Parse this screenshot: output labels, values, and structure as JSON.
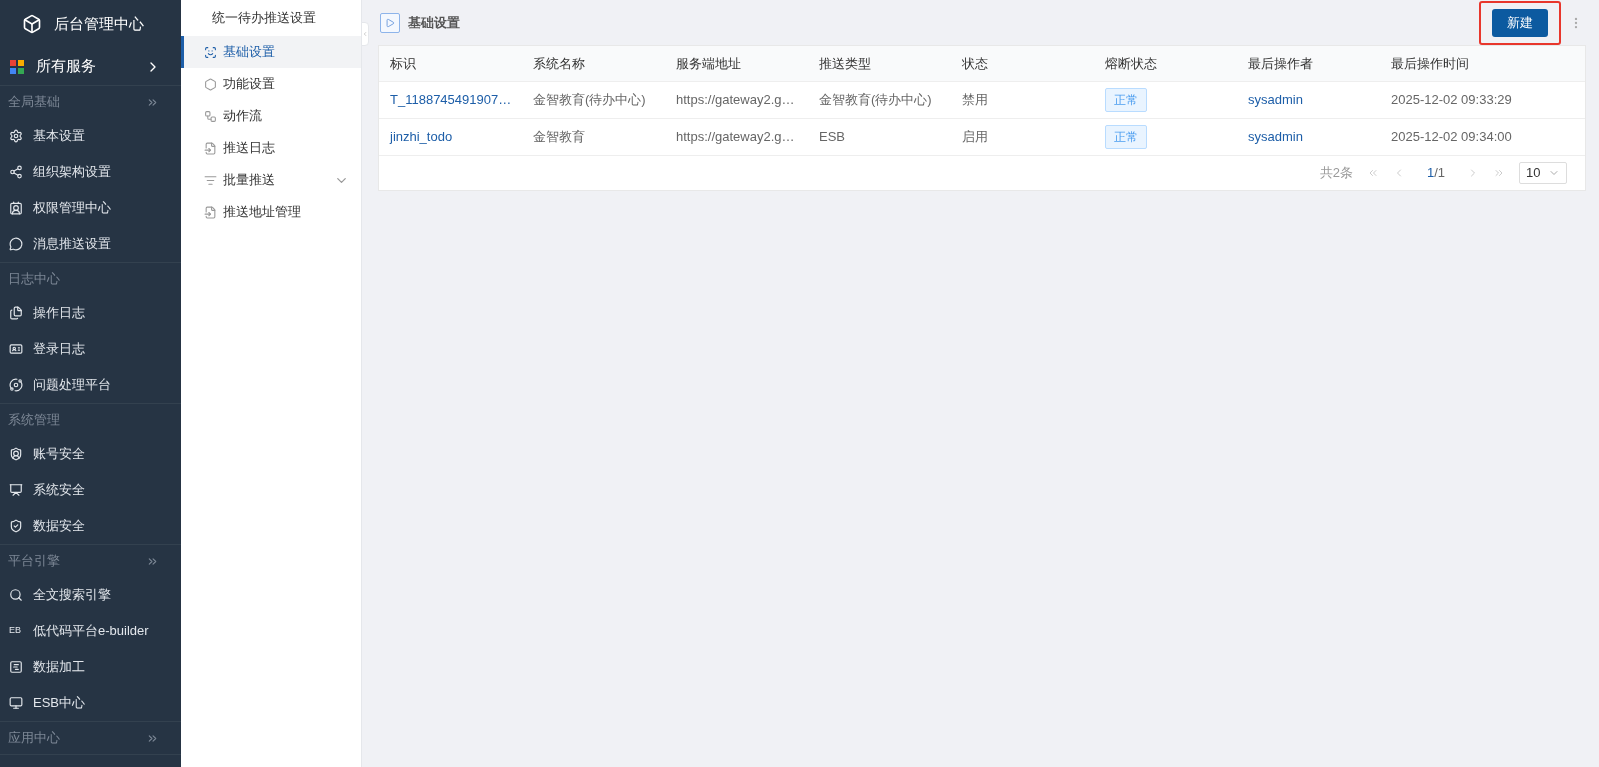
{
  "app": {
    "title": "后台管理中心"
  },
  "all_services": {
    "label": "所有服务"
  },
  "sidebar": [
    {
      "title": "全局基础",
      "expandable": true,
      "items": [
        {
          "label": "基本设置"
        },
        {
          "label": "组织架构设置"
        },
        {
          "label": "权限管理中心"
        },
        {
          "label": "消息推送设置"
        }
      ]
    },
    {
      "title": "日志中心",
      "expandable": false,
      "items": [
        {
          "label": "操作日志"
        },
        {
          "label": "登录日志"
        },
        {
          "label": "问题处理平台"
        }
      ]
    },
    {
      "title": "系统管理",
      "expandable": false,
      "items": [
        {
          "label": "账号安全"
        },
        {
          "label": "系统安全"
        },
        {
          "label": "数据安全"
        }
      ]
    },
    {
      "title": "平台引擎",
      "expandable": true,
      "items": [
        {
          "label": "全文搜索引擎"
        },
        {
          "label": "低代码平台e-builder",
          "badge": "EB"
        },
        {
          "label": "数据加工"
        },
        {
          "label": "ESB中心"
        }
      ]
    },
    {
      "title": "应用中心",
      "expandable": true
    }
  ],
  "submenu": {
    "title": "统一待办推送设置",
    "items": [
      {
        "label": "基础设置",
        "kind": "item",
        "selected": true
      },
      {
        "label": "功能设置",
        "kind": "item",
        "selected": false
      },
      {
        "label": "动作流",
        "kind": "item",
        "selected": false
      },
      {
        "label": "推送日志",
        "kind": "item",
        "selected": false
      },
      {
        "label": "批量推送",
        "kind": "group",
        "selected": false,
        "expanded": false
      },
      {
        "label": "推送地址管理",
        "kind": "item",
        "selected": false
      }
    ]
  },
  "page": {
    "title": "基础设置",
    "new_button": "新建",
    "highlighted": true
  },
  "table": {
    "columns": [
      "标识",
      "系统名称",
      "服务端地址",
      "推送类型",
      "状态",
      "熔断状态",
      "最后操作者",
      "最后操作时间"
    ],
    "rows": [
      {
        "id": "T_1188745491907…",
        "system_name": "金智教育(待办中心)",
        "url": "https://gateway2.g…",
        "push_type": "金智教育(待办中心)",
        "status": "禁用",
        "breaker": "正常",
        "operator": "sysadmin",
        "time": "2025-12-02 09:33:29"
      },
      {
        "id": "jinzhi_todo",
        "system_name": "金智教育",
        "url": "https://gateway2.g…",
        "push_type": "ESB",
        "status": "启用",
        "breaker": "正常",
        "operator": "sysadmin",
        "time": "2025-12-02 09:34:00"
      }
    ]
  },
  "pagination": {
    "total": "共2条",
    "current": "1",
    "pages": "/1",
    "page_size": "10"
  }
}
